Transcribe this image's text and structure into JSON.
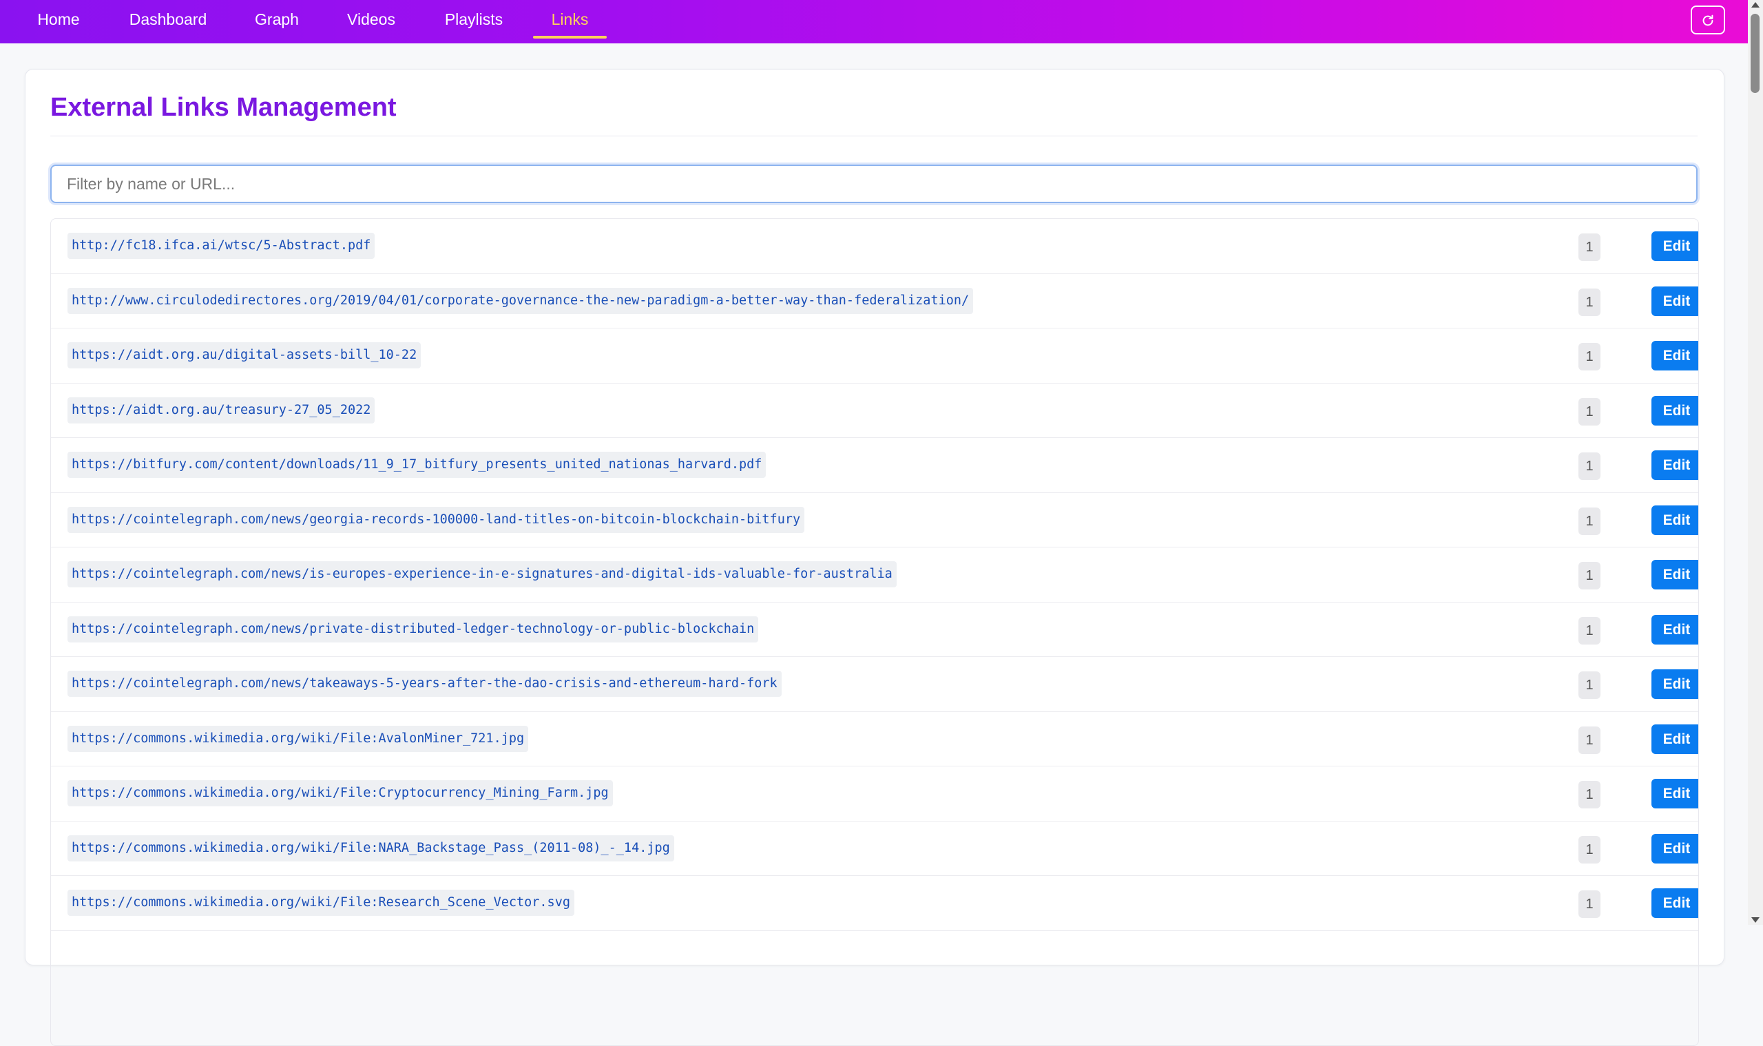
{
  "nav": {
    "items": [
      {
        "label": "Home"
      },
      {
        "label": "Dashboard"
      },
      {
        "label": "Graph"
      },
      {
        "label": "Videos"
      },
      {
        "label": "Playlists"
      },
      {
        "label": "Links",
        "active": true
      }
    ],
    "refresh_icon": "refresh-icon"
  },
  "colors": {
    "nav_gradient_start": "#8a12f0",
    "nav_gradient_end": "#ea0cd6",
    "active_tab": "#ffd35a",
    "title": "#7a18e0",
    "edit_button": "#0a7cf0",
    "link_text": "#1a4fb8"
  },
  "main": {
    "title": "External Links Management",
    "filter": {
      "placeholder": "Filter by name or URL...",
      "value": ""
    },
    "edit_label": "Edit",
    "links": [
      {
        "url": "http://fc18.ifca.ai/wtsc/5-Abstract.pdf",
        "count": "1"
      },
      {
        "url": "http://www.circulodedirectores.org/2019/04/01/corporate-governance-the-new-paradigm-a-better-way-than-federalization/",
        "count": "1"
      },
      {
        "url": "https://aidt.org.au/digital-assets-bill_10-22",
        "count": "1"
      },
      {
        "url": "https://aidt.org.au/treasury-27_05_2022",
        "count": "1"
      },
      {
        "url": "https://bitfury.com/content/downloads/11_9_17_bitfury_presents_united_nationas_harvard.pdf",
        "count": "1"
      },
      {
        "url": "https://cointelegraph.com/news/georgia-records-100000-land-titles-on-bitcoin-blockchain-bitfury",
        "count": "1"
      },
      {
        "url": "https://cointelegraph.com/news/is-europes-experience-in-e-signatures-and-digital-ids-valuable-for-australia",
        "count": "1"
      },
      {
        "url": "https://cointelegraph.com/news/private-distributed-ledger-technology-or-public-blockchain",
        "count": "1"
      },
      {
        "url": "https://cointelegraph.com/news/takeaways-5-years-after-the-dao-crisis-and-ethereum-hard-fork",
        "count": "1"
      },
      {
        "url": "https://commons.wikimedia.org/wiki/File:AvalonMiner_721.jpg",
        "count": "1"
      },
      {
        "url": "https://commons.wikimedia.org/wiki/File:Cryptocurrency_Mining_Farm.jpg",
        "count": "1"
      },
      {
        "url": "https://commons.wikimedia.org/wiki/File:NARA_Backstage_Pass_(2011-08)_-_14.jpg",
        "count": "1"
      },
      {
        "url": "https://commons.wikimedia.org/wiki/File:Research_Scene_Vector.svg",
        "count": "1"
      }
    ]
  }
}
